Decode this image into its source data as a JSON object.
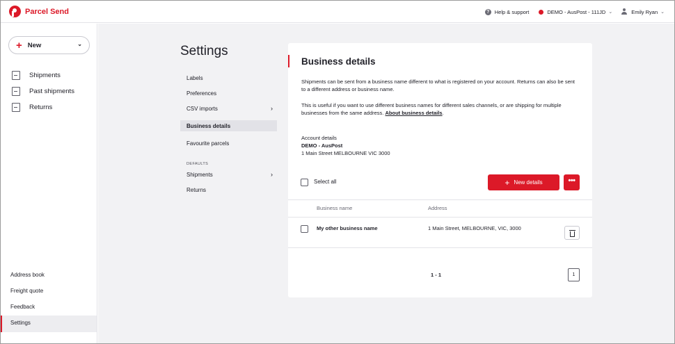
{
  "topbar": {
    "brand": "Parcel Send",
    "help_label": "Help & support",
    "account_label": "DEMO - AusPost - 111JD",
    "user_label": "Emily Ryan",
    "brand_color": "#dc1928"
  },
  "sidebar": {
    "new_label": "New",
    "items": [
      {
        "label": "Shipments",
        "icon": "shipments-icon"
      },
      {
        "label": "Past shipments",
        "icon": "past-shipments-icon"
      },
      {
        "label": "Returns",
        "icon": "returns-icon"
      }
    ],
    "bottom_items": [
      "Address book",
      "Freight quote",
      "Feedback",
      "Settings"
    ],
    "active_bottom": "Settings"
  },
  "settings": {
    "title": "Settings",
    "nav": {
      "labels": "Labels",
      "preferences": "Preferences",
      "csv_imports": "CSV imports",
      "business_details": "Business details",
      "favourite_parcels": "Favourite parcels",
      "defaults_heading": "DEFAULTS",
      "shipments": "Shipments",
      "returns": "Returns"
    },
    "active": "Business details"
  },
  "card": {
    "title": "Business details",
    "para1": "Shipments can be sent from a business name different to what is registered on your account. Returns can also be sent to a different address or business name.",
    "para2_text": "This is useful if you want to use different business names for different sales channels, or are shipping for multiple businesses from the same address. ",
    "para2_link": "About business details",
    "para2_end": ".",
    "account_title": "Account details",
    "account_name": "DEMO - AusPost",
    "account_address": "1 Main Street MELBOURNE VIC 3000",
    "select_all": "Select all",
    "new_details": "New details",
    "more": "•••",
    "columns": {
      "name": "Business name",
      "address": "Address"
    },
    "rows": [
      {
        "name": "My other business name",
        "address": "1 Main Street, MELBOURNE, VIC, 3000"
      }
    ],
    "pager_range": "1 - 1",
    "pager_page": "1"
  }
}
